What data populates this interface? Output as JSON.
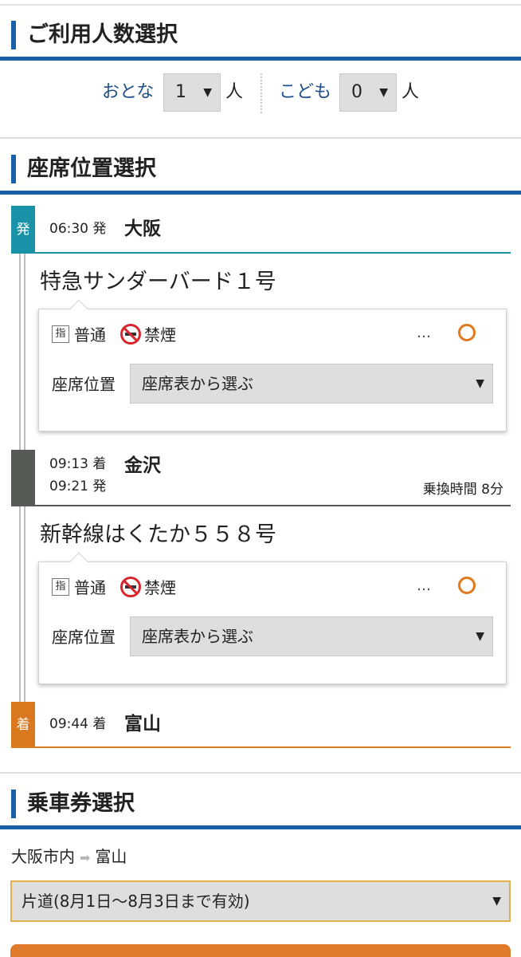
{
  "people": {
    "title": "ご利用人数選択",
    "adult_label": "おとな",
    "adult_value": "1",
    "adult_unit": "人",
    "child_label": "こども",
    "child_value": "0",
    "child_unit": "人"
  },
  "seat": {
    "title": "座席位置選択",
    "depart": {
      "badge": "発",
      "time": "06:30 発",
      "station": "大阪"
    },
    "train1": {
      "name": "特急サンダーバード１号",
      "class_label": "普通",
      "smoke_label": "禁煙",
      "more": "…",
      "seat_label": "座席位置",
      "seat_value": "座席表から選ぶ"
    },
    "transfer": {
      "arrive_time": "09:13 着",
      "depart_time": "09:21 発",
      "station": "金沢",
      "transfer_text": "乗換時間 8分"
    },
    "train2": {
      "name": "新幹線はくたか５５８号",
      "class_label": "普通",
      "smoke_label": "禁煙",
      "more": "…",
      "seat_label": "座席位置",
      "seat_value": "座席表から選ぶ"
    },
    "arrive": {
      "badge": "着",
      "time": "09:44 着",
      "station": "富山"
    }
  },
  "ticket": {
    "title": "乗車券選択",
    "from": "大阪市内",
    "to": "富山",
    "ticket_value": "片道(8月1日～8月3日まで有効)"
  },
  "icons": {
    "reserved": "指",
    "arrow": "➡",
    "dropdown": "▼"
  },
  "colors": {
    "accent_blue": "#1b5fa8",
    "depart_teal": "#1a93a8",
    "transfer_gray": "#565a54",
    "arrive_orange": "#d9781f"
  }
}
